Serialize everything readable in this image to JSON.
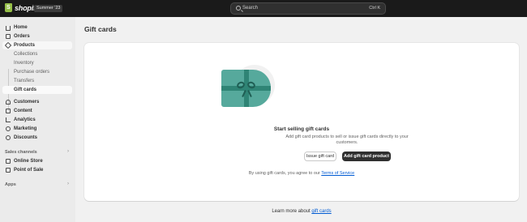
{
  "topbar": {
    "brand_name": "shopify",
    "edition_badge": "Summer '23",
    "search_placeholder": "Search",
    "search_shortcut": "Ctrl K"
  },
  "sidebar": {
    "items": [
      {
        "label": "Home",
        "icon": "home-icon"
      },
      {
        "label": "Orders",
        "icon": "orders-icon"
      },
      {
        "label": "Products",
        "icon": "tag-icon"
      },
      {
        "label": "Collections"
      },
      {
        "label": "Inventory"
      },
      {
        "label": "Purchase orders"
      },
      {
        "label": "Transfers"
      },
      {
        "label": "Gift cards"
      },
      {
        "label": "Customers",
        "icon": "person-icon"
      },
      {
        "label": "Content",
        "icon": "content-icon"
      },
      {
        "label": "Analytics",
        "icon": "analytics-icon"
      },
      {
        "label": "Marketing",
        "icon": "target-icon"
      },
      {
        "label": "Discounts",
        "icon": "discount-icon"
      }
    ],
    "sales_channels_label": "Sales channels",
    "channels": [
      {
        "label": "Online Store",
        "icon": "store-icon"
      },
      {
        "label": "Point of Sale",
        "icon": "pos-icon"
      }
    ],
    "apps_label": "Apps",
    "chevron": "›"
  },
  "main": {
    "page_title": "Gift cards",
    "empty_state": {
      "heading": "Start selling gift cards",
      "description": "Add gift card products to sell or issue gift cards directly to your customers.",
      "secondary_button": "Issue gift card",
      "primary_button": "Add gift card product",
      "terms_prefix": "By using gift cards, you agree to our ",
      "terms_link": "Terms of Service"
    },
    "footer": {
      "prefix": "Learn more about ",
      "link": "gift cards"
    }
  },
  "colors": {
    "topbar": "#1a1a1a",
    "sidebar": "#ebebeb",
    "primary_button": "#303030",
    "link": "#005bd3",
    "gift_card": "#56a99c"
  }
}
